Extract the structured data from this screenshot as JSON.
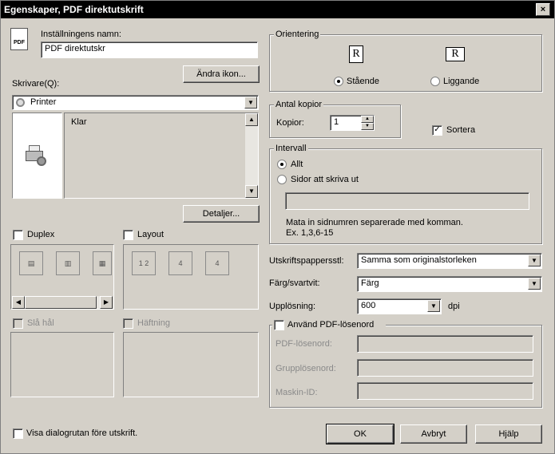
{
  "window": {
    "title": "Egenskaper, PDF direktutskrift",
    "close_label": "×"
  },
  "left": {
    "setting_name_label": "Inställningens namn:",
    "setting_name_value": "PDF direktutskr",
    "change_icon_button": "Ändra ikon...",
    "printer_label": "Skrivare(Q):",
    "printer_selected": "Printer",
    "printer_status": "Klar",
    "details_button": "Detaljer...",
    "duplex_label": "Duplex",
    "layout_label": "Layout",
    "hole_punch_label": "Slå hål",
    "stapling_label": "Häftning",
    "show_dialog_label": "Visa dialogrutan före utskrift.",
    "pdf_icon_text": "PDF",
    "layout_icons": [
      "1 2",
      "4",
      "4"
    ]
  },
  "orientation": {
    "title": "Orientering",
    "portrait_label": "Stående",
    "landscape_label": "Liggande",
    "selected": "portrait",
    "glyph": "R"
  },
  "copies": {
    "title": "Antal kopior",
    "copies_label": "Kopior:",
    "value": "1",
    "collate_label": "Sortera",
    "collate_checked": true
  },
  "range": {
    "title": "Intervall",
    "all_label": "Allt",
    "pages_label": "Sidor att skriva ut",
    "hint_line1": "Mata in sidnumren separerade med komman.",
    "hint_line2": "Ex. 1,3,6-15"
  },
  "options": {
    "paper_size_label": "Utskriftspappersstl:",
    "paper_size_value": "Samma som originalstorleken",
    "color_label": "Färg/svartvit:",
    "color_value": "Färg",
    "resolution_label": "Upplösning:",
    "resolution_value": "600",
    "resolution_unit": "dpi"
  },
  "pdf_password": {
    "title": "Använd PDF-lösenord",
    "pdf_password_label": "PDF-lösenord:",
    "group_password_label": "Grupplösenord:",
    "machine_id_label": "Maskin-ID:"
  },
  "buttons": {
    "ok": "OK",
    "cancel": "Avbryt",
    "help": "Hjälp"
  }
}
